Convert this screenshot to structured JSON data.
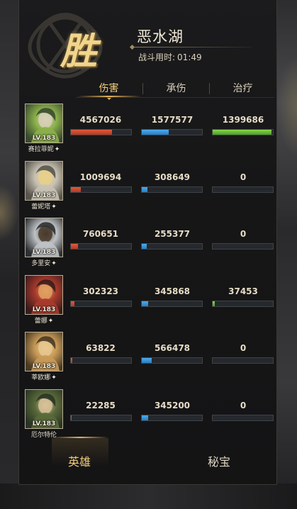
{
  "header": {
    "result_char": "胜",
    "map_name": "恶水湖",
    "duration_label": "战斗用时:",
    "duration_value": "01:49"
  },
  "tabs": [
    {
      "label": "伤害",
      "active": true
    },
    {
      "label": "承伤",
      "active": false
    },
    {
      "label": "治疗",
      "active": false
    }
  ],
  "heroes": [
    {
      "name": "赛拉菲妮",
      "level": "LV.183",
      "has_star": true,
      "damage": "4567026",
      "damage_frac": 0.68,
      "taken": "1577577",
      "taken_frac": 0.45,
      "heal": "1399686",
      "heal_frac": 0.98,
      "portrait_colors": [
        "#3a4a30",
        "#8bb04a",
        "#d8d0b8"
      ]
    },
    {
      "name": "蕾妮塔",
      "level": "LV.183",
      "has_star": true,
      "damage": "1009694",
      "damage_frac": 0.16,
      "taken": "308649",
      "taken_frac": 0.09,
      "heal": "0",
      "heal_frac": 0,
      "portrait_colors": [
        "#58554c",
        "#c8c2b4",
        "#e8d08a"
      ]
    },
    {
      "name": "多里安",
      "level": "LV.183",
      "has_star": true,
      "damage": "760651",
      "damage_frac": 0.12,
      "taken": "255377",
      "taken_frac": 0.08,
      "heal": "0",
      "heal_frac": 0,
      "portrait_colors": [
        "#2e3032",
        "#bfc3c6",
        "#4a3a2c"
      ]
    },
    {
      "name": "蕾娜",
      "level": "LV.183",
      "has_star": true,
      "damage": "302323",
      "damage_frac": 0.06,
      "taken": "345868",
      "taken_frac": 0.1,
      "heal": "37453",
      "heal_frac": 0.03,
      "portrait_colors": [
        "#3b1c1c",
        "#a83a2c",
        "#e0a060"
      ]
    },
    {
      "name": "莘欧娜",
      "level": "LV.183",
      "has_star": true,
      "damage": "63822",
      "damage_frac": 0.02,
      "taken": "566478",
      "taken_frac": 0.17,
      "heal": "0",
      "heal_frac": 0,
      "portrait_colors": [
        "#4a3a22",
        "#c89a58",
        "#e8c890"
      ]
    },
    {
      "name": "厄尔特伦",
      "level": "LV.183",
      "has_star": false,
      "damage": "22285",
      "damage_frac": 0.01,
      "taken": "345200",
      "taken_frac": 0.1,
      "heal": "0",
      "heal_frac": 0,
      "portrait_colors": [
        "#2a3424",
        "#5a6a3a",
        "#d8c29a"
      ]
    }
  ],
  "bottom_tabs": [
    {
      "label": "英雄",
      "active": true
    },
    {
      "label": "秘宝",
      "active": false
    }
  ],
  "colors": {
    "damage_bar": "#d24a30",
    "taken_bar": "#3a9ae0",
    "heal_bar": "#6cc03a",
    "accent_gold": "#f4ce7c"
  },
  "star_glyph": "✦"
}
